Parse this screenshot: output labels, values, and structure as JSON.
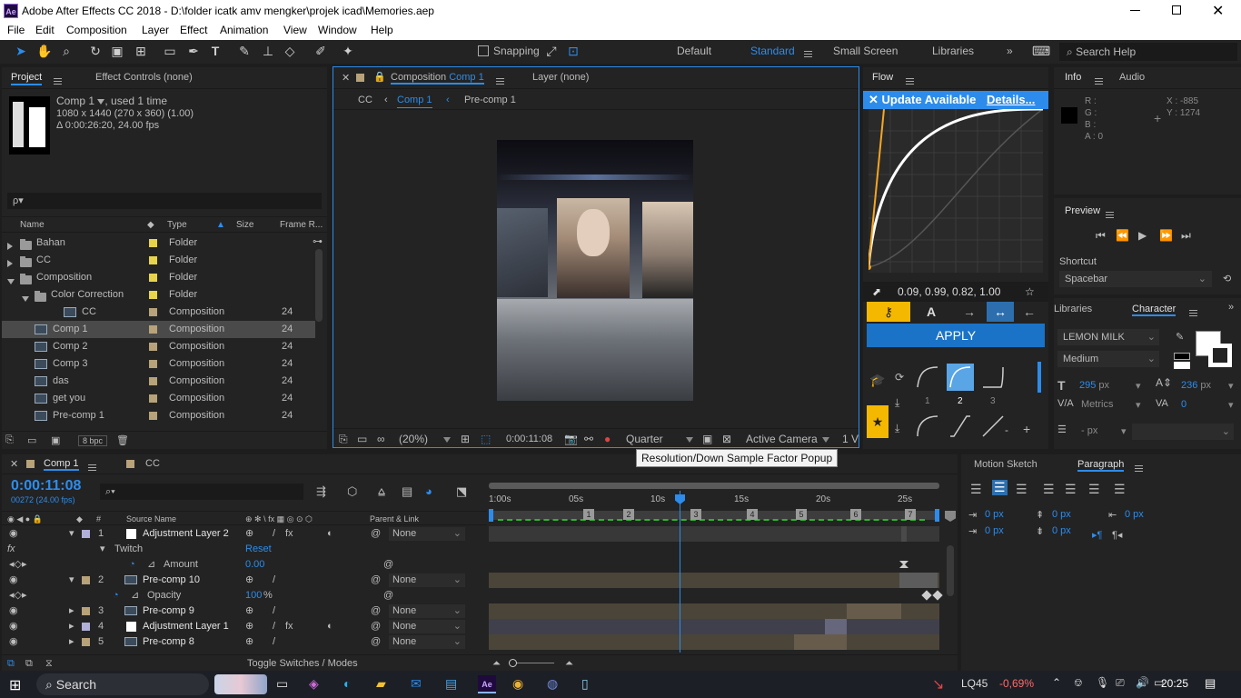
{
  "title": "Adobe After Effects CC 2018 - D:\\folder icatk amv mengker\\projek icad\\Memories.aep",
  "app_badge": "Ae",
  "menu": [
    "File",
    "Edit",
    "Composition",
    "Layer",
    "Effect",
    "Animation",
    "View",
    "Window",
    "Help"
  ],
  "toolbar": {
    "snapping": "Snapping",
    "workspaces": [
      "Default",
      "Standard",
      "Small Screen",
      "Libraries"
    ],
    "active_workspace": "Standard",
    "search_placeholder": "Search Help"
  },
  "project": {
    "tab": "Project",
    "effect_controls": "Effect Controls (none)",
    "comp_name": "Comp 1",
    "used": ", used 1 time",
    "dims": "1080 x 1440  (270 x 360) (1.00)",
    "duration": "Δ 0:00:26:20, 24.00 fps",
    "search_placeholder": "ρ▾",
    "columns": {
      "name": "Name",
      "type": "Type",
      "size": "Size",
      "frame": "Frame R..."
    },
    "items": [
      {
        "name": "Bahan",
        "type": "Folder",
        "fr": "",
        "kind": "folder",
        "indent": 0,
        "color": "#e8d44a"
      },
      {
        "name": "CC",
        "type": "Folder",
        "fr": "",
        "kind": "folder",
        "indent": 0,
        "color": "#e8d44a"
      },
      {
        "name": "Composition",
        "type": "Folder",
        "fr": "",
        "kind": "folder",
        "indent": 0,
        "open": true,
        "color": "#e8d44a"
      },
      {
        "name": "Color Correction",
        "type": "Folder",
        "fr": "",
        "kind": "folder",
        "indent": 1,
        "open": true,
        "color": "#e8d44a"
      },
      {
        "name": "CC",
        "type": "Composition",
        "fr": "24",
        "kind": "comp",
        "indent": 2,
        "color": "#b7a27a"
      },
      {
        "name": "Comp 1",
        "type": "Composition",
        "fr": "24",
        "kind": "comp",
        "indent": 0,
        "selected": true,
        "color": "#b7a27a"
      },
      {
        "name": "Comp 2",
        "type": "Composition",
        "fr": "24",
        "kind": "comp",
        "indent": 0,
        "color": "#b7a27a"
      },
      {
        "name": "Comp 3",
        "type": "Composition",
        "fr": "24",
        "kind": "comp",
        "indent": 0,
        "color": "#b7a27a"
      },
      {
        "name": "das",
        "type": "Composition",
        "fr": "24",
        "kind": "comp",
        "indent": 0,
        "color": "#b7a27a"
      },
      {
        "name": "get you",
        "type": "Composition",
        "fr": "24",
        "kind": "comp",
        "indent": 0,
        "color": "#b7a27a"
      },
      {
        "name": "Pre-comp 1",
        "type": "Composition",
        "fr": "24",
        "kind": "comp",
        "indent": 0,
        "color": "#b7a27a"
      }
    ],
    "bpc": "8 bpc"
  },
  "viewer": {
    "tab_prefix": "Composition",
    "tab_comp": "Comp 1",
    "layer_tab": "Layer (none)",
    "crumbs": [
      "CC",
      "Comp 1",
      "Pre-comp 1"
    ],
    "zoom": "(20%)",
    "timecode": "0:00:11:08",
    "resolution": "Quarter",
    "camera": "Active Camera",
    "views": "1 V",
    "tooltip": "Resolution/Down Sample Factor Popup"
  },
  "flow": {
    "title": "Flow",
    "update": "Update Available",
    "details": "Details...",
    "values": "0.09, 0.99, 0.82, 1.00",
    "apply": "APPLY",
    "preset_nums": [
      "1",
      "2",
      "3"
    ]
  },
  "info": {
    "tab": "Info",
    "audio": "Audio",
    "r": "R :",
    "g": "G :",
    "b": "B :",
    "a": "A :  0",
    "x": "X : -885",
    "y": "Y : 1274"
  },
  "preview": {
    "title": "Preview",
    "shortcut_label": "Shortcut",
    "shortcut": "Spacebar"
  },
  "character": {
    "libraries": "Libraries",
    "tab": "Character",
    "font": "LEMON MILK",
    "style": "Medium",
    "size": "295",
    "size_unit": "px",
    "leading": "236",
    "leading_unit": "px",
    "kerning": "Metrics",
    "tracking": "0",
    "px": "- px"
  },
  "timeline": {
    "tab": "Comp 1",
    "tab2": "CC",
    "time": "0:00:11:08",
    "frames": "00272 (24.00 fps)",
    "ruler": [
      "1:00s",
      "05s",
      "10s",
      "15s",
      "20s",
      "25s"
    ],
    "toggle": "Toggle Switches / Modes",
    "cols": {
      "num": "#",
      "source": "Source Name",
      "parent": "Parent & Link"
    },
    "markers": [
      "1",
      "2",
      "3",
      "4",
      "5",
      "6",
      "7"
    ],
    "layers": [
      {
        "type": "layer",
        "num": "1",
        "name": "Adjustment Layer 2",
        "parent": "None",
        "color": "#b0b0d8",
        "icon": "white"
      },
      {
        "type": "fx",
        "label": "Twitch",
        "value": "Reset"
      },
      {
        "type": "prop",
        "label": "Amount",
        "value": "0.00"
      },
      {
        "type": "layer",
        "num": "2",
        "name": "Pre-comp 10",
        "parent": "None",
        "color": "#b7a27a",
        "icon": "comp"
      },
      {
        "type": "prop2",
        "label": "Opacity",
        "value": "100",
        "unit": "%"
      },
      {
        "type": "layer",
        "num": "3",
        "name": "Pre-comp 9",
        "parent": "None",
        "color": "#b7a27a",
        "icon": "comp"
      },
      {
        "type": "layer",
        "num": "4",
        "name": "Adjustment Layer 1",
        "parent": "None",
        "color": "#b0b0d8",
        "icon": "white"
      },
      {
        "type": "layer",
        "num": "5",
        "name": "Pre-comp 8",
        "parent": "None",
        "color": "#b7a27a",
        "icon": "comp"
      }
    ]
  },
  "motion": {
    "tab": "Motion Sketch",
    "paragraph": "Paragraph",
    "v1": "0 px",
    "v2": "0 px",
    "v3": "0 px",
    "v4": "0 px",
    "v5": "0 px"
  },
  "taskbar": {
    "search": "Search",
    "ticker": "LQ45",
    "change": "-0,69%",
    "time": "20:25"
  }
}
